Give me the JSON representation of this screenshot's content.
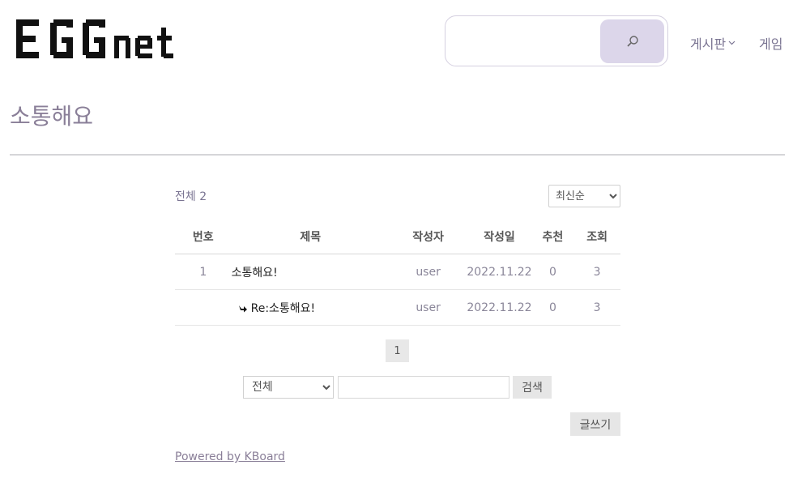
{
  "header": {
    "logo_text": "EGGnet",
    "search": {
      "placeholder": ""
    },
    "nav": {
      "board_label": "게시판",
      "game_label": "게임"
    }
  },
  "page": {
    "title": "소통해요"
  },
  "board": {
    "total_label": "전체 2",
    "sort": {
      "selected": "최신순"
    },
    "columns": [
      "번호",
      "제목",
      "작성자",
      "작성일",
      "추천",
      "조회"
    ],
    "rows": [
      {
        "number": "1",
        "title": "소통해요!",
        "author": "user",
        "date": "2022.11.22",
        "votes": "0",
        "views": "3",
        "is_reply": false
      },
      {
        "number": "",
        "title": "Re:소통해요!",
        "author": "user",
        "date": "2022.11.22",
        "votes": "0",
        "views": "3",
        "is_reply": true
      }
    ],
    "pagination": {
      "current": "1"
    },
    "search": {
      "target_selected": "전체",
      "keyword": "",
      "submit_label": "검색"
    },
    "write_label": "글쓰기",
    "powered_by": "Powered by KBoard"
  },
  "colors": {
    "accent": "#dcd6ea",
    "title": "#8a7f98",
    "nav_text": "#7a7492"
  }
}
